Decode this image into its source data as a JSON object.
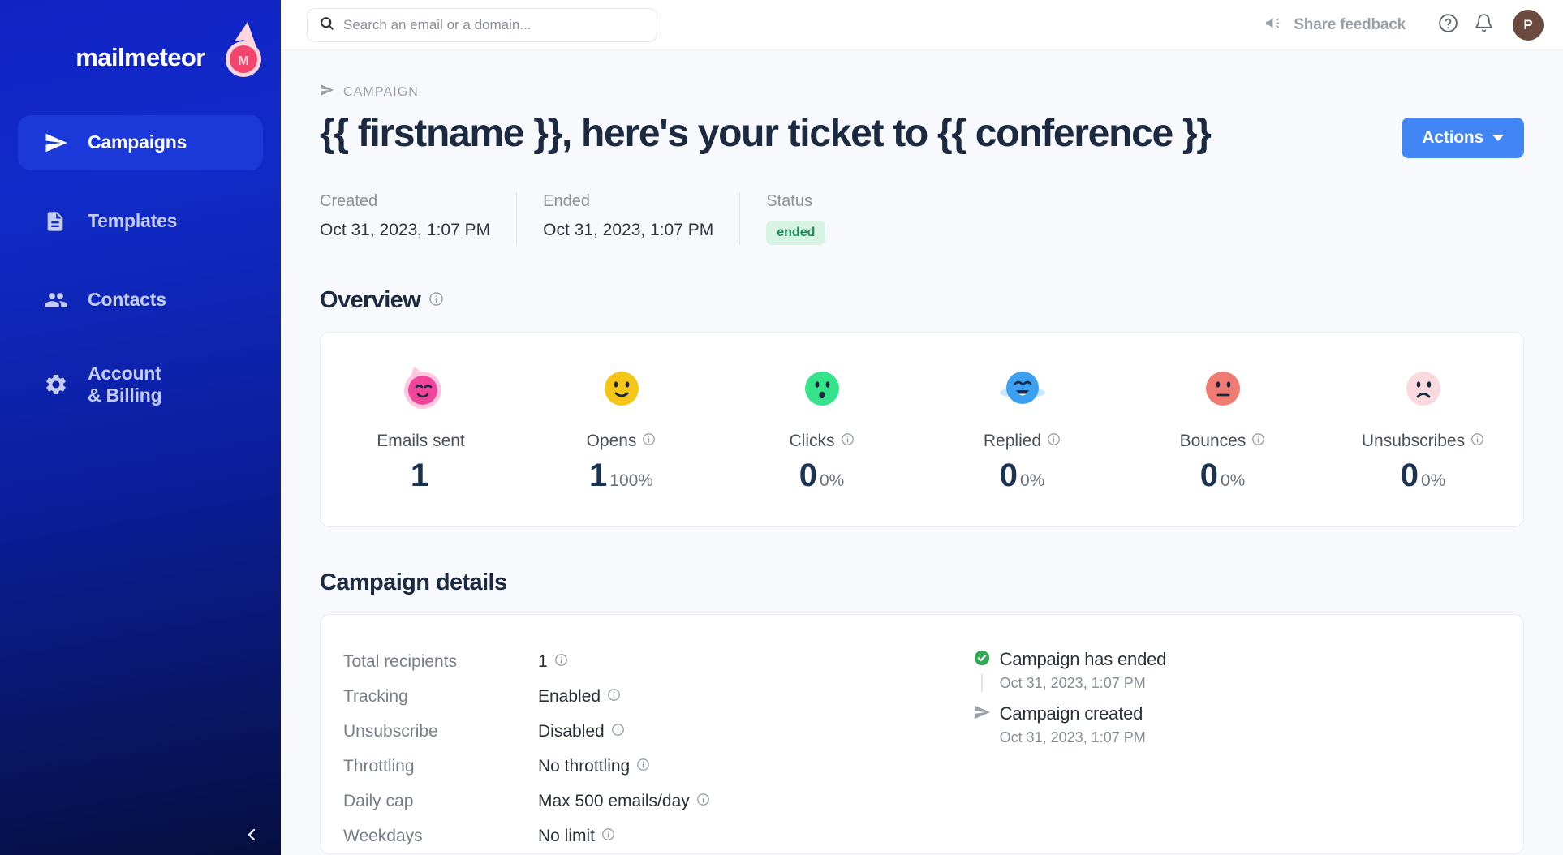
{
  "brand": {
    "name": "mailmeteor",
    "logo_icon": "meteor-logo-icon",
    "accent": "#1b38d8",
    "meteor_color": "#f1456b"
  },
  "sidebar": {
    "items": [
      {
        "label": "Campaigns",
        "icon": "send-icon",
        "active": true
      },
      {
        "label": "Templates",
        "icon": "document-icon",
        "active": false
      },
      {
        "label": "Contacts",
        "icon": "people-icon",
        "active": false
      },
      {
        "label": "Account",
        "label2": "& Billing",
        "icon": "gear-icon",
        "active": false
      }
    ],
    "collapse_icon": "chevron-left-icon"
  },
  "topbar": {
    "search": {
      "placeholder": "Search an email or a domain...",
      "value": "",
      "icon": "search-icon"
    },
    "feedback_label": "Share feedback",
    "feedback_icon": "megaphone-icon",
    "help_icon": "help-circle-icon",
    "notifications_icon": "bell-icon",
    "avatar_initial": "P",
    "avatar_color": "#6b4a3f"
  },
  "header": {
    "breadcrumb": "CAMPAIGN",
    "breadcrumb_icon": "send-icon",
    "title": "{{ firstname }}, here's your ticket to {{ conference }}",
    "actions_label": "Actions"
  },
  "meta": [
    {
      "label": "Created",
      "value": "Oct 31, 2023, 1:07 PM",
      "type": "text"
    },
    {
      "label": "Ended",
      "value": "Oct 31, 2023, 1:07 PM",
      "type": "text"
    },
    {
      "label": "Status",
      "value": "ended",
      "type": "badge",
      "badge_bg": "#d7f3e3",
      "badge_fg": "#1e8a5a"
    }
  ],
  "overview": {
    "title": "Overview",
    "info_icon": "info-icon",
    "stats": [
      {
        "label": "Emails sent",
        "value": "1",
        "percent": "",
        "emoji": "meteor-face-emoji",
        "has_info": false
      },
      {
        "label": "Opens",
        "value": "1",
        "percent": "100%",
        "emoji": "smiling-face-emoji",
        "has_info": true
      },
      {
        "label": "Clicks",
        "value": "0",
        "percent": "0%",
        "emoji": "surprised-face-emoji",
        "has_info": true
      },
      {
        "label": "Replied",
        "value": "0",
        "percent": "0%",
        "emoji": "laughing-planet-emoji",
        "has_info": true
      },
      {
        "label": "Bounces",
        "value": "0",
        "percent": "0%",
        "emoji": "neutral-face-emoji",
        "has_info": true
      },
      {
        "label": "Unsubscribes",
        "value": "0",
        "percent": "0%",
        "emoji": "sad-face-emoji",
        "has_info": true
      }
    ]
  },
  "details": {
    "title": "Campaign details",
    "rows": [
      {
        "label": "Total recipients",
        "value": "1"
      },
      {
        "label": "Tracking",
        "value": "Enabled"
      },
      {
        "label": "Unsubscribe",
        "value": "Disabled"
      },
      {
        "label": "Throttling",
        "value": "No throttling"
      },
      {
        "label": "Daily cap",
        "value": "Max 500 emails/day"
      },
      {
        "label": "Weekdays",
        "value": "No limit"
      }
    ],
    "timeline": [
      {
        "title": "Campaign has ended",
        "time": "Oct 31, 2023, 1:07 PM",
        "icon": "check-circle-icon",
        "icon_color": "#34a853"
      },
      {
        "title": "Campaign created",
        "time": "Oct 31, 2023, 1:07 PM",
        "icon": "send-icon",
        "icon_color": "#9aa0a8"
      }
    ]
  }
}
